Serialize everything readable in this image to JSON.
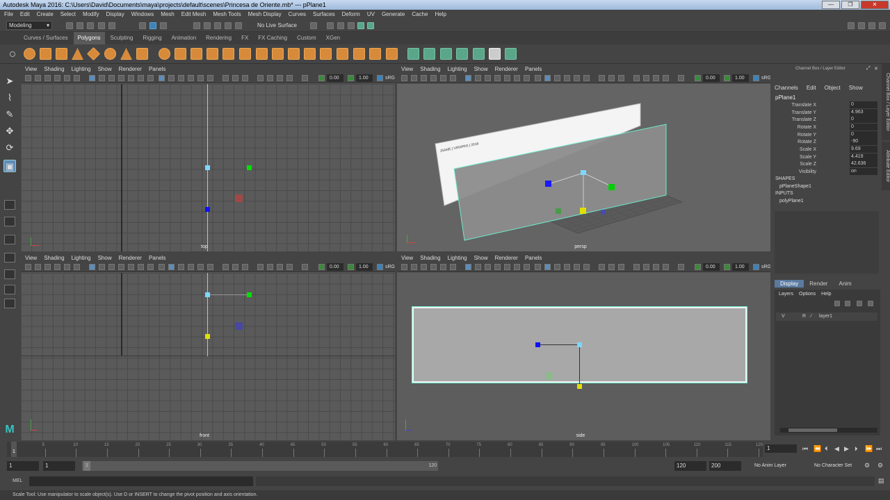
{
  "window": {
    "title": "Autodesk Maya 2016: C:\\Users\\David\\Documents\\maya\\projects\\default\\scenes\\Princesa de Oriente.mb*  ---  pPlane1"
  },
  "menu": [
    "File",
    "Edit",
    "Create",
    "Select",
    "Modify",
    "Display",
    "Windows",
    "Mesh",
    "Edit Mesh",
    "Mesh Tools",
    "Mesh Display",
    "Curves",
    "Surfaces",
    "Deform",
    "UV",
    "Generate",
    "Cache",
    "Help"
  ],
  "status_line": {
    "workspace": "Modeling",
    "live_surface": "No Live Surface"
  },
  "shelf": {
    "tabs": [
      "Curves / Surfaces",
      "Polygons",
      "Sculpting",
      "Rigging",
      "Animation",
      "Rendering",
      "FX",
      "FX Caching",
      "Custom",
      "XGen"
    ],
    "active": "Polygons"
  },
  "panel_menu": [
    "View",
    "Shading",
    "Lighting",
    "Show",
    "Renderer",
    "Panels"
  ],
  "panel_toolbar": {
    "exposure": "0.00",
    "gamma": "1.00",
    "color_space": "sRG"
  },
  "viewports": {
    "top": "top",
    "persp": "persp",
    "front": "front",
    "side": "side"
  },
  "persp_sign_text": "JSANE | VIRAPAS | 2016",
  "channel_box": {
    "header": "Channel Box / Layer Editor",
    "menu": [
      "Channels",
      "Edit",
      "Object",
      "Show"
    ],
    "object": "pPlane1",
    "attributes": [
      {
        "label": "Translate X",
        "value": "0"
      },
      {
        "label": "Translate Y",
        "value": "4.963"
      },
      {
        "label": "Translate Z",
        "value": "0"
      },
      {
        "label": "Rotate X",
        "value": "0"
      },
      {
        "label": "Rotate Y",
        "value": "0"
      },
      {
        "label": "Rotate Z",
        "value": "-90"
      },
      {
        "label": "Scale X",
        "value": "9.69"
      },
      {
        "label": "Scale Y",
        "value": "4.419"
      },
      {
        "label": "Scale Z",
        "value": "42.636"
      },
      {
        "label": "Visibility",
        "value": "on"
      }
    ],
    "shapes_title": "SHAPES",
    "shape": "pPlaneShape1",
    "inputs_title": "INPUTS",
    "input": "polyPlane1"
  },
  "side_tabs": {
    "channel_box": "Channel Box / Layer Editor",
    "attribute_editor": "Attribute Editor"
  },
  "layer_editor": {
    "tabs": [
      "Display",
      "Render",
      "Anim"
    ],
    "active_tab": "Display",
    "menu": [
      "Layers",
      "Options",
      "Help"
    ],
    "layer": {
      "v": "V",
      "r": "R",
      "name": "layer1"
    }
  },
  "timeslider": {
    "ticks": [
      "5",
      "10",
      "15",
      "20",
      "25",
      "30",
      "35",
      "40",
      "45",
      "50",
      "55",
      "60",
      "65",
      "70",
      "75",
      "80",
      "85",
      "90",
      "95",
      "100",
      "105",
      "110",
      "115",
      "120"
    ],
    "current_marker": "1",
    "current_frame": "1"
  },
  "range": {
    "start": "1",
    "playback_start": "1",
    "slider_start": "1",
    "slider_end": "120",
    "playback_end": "120",
    "end": "200",
    "anim_layer": "No Anim Layer",
    "character_set": "No Character Set"
  },
  "command_line": {
    "label": "MEL"
  },
  "help_line": "Scale Tool: Use manipulator to scale object(s). Use D or INSERT to change the pivot position and axis orientation."
}
